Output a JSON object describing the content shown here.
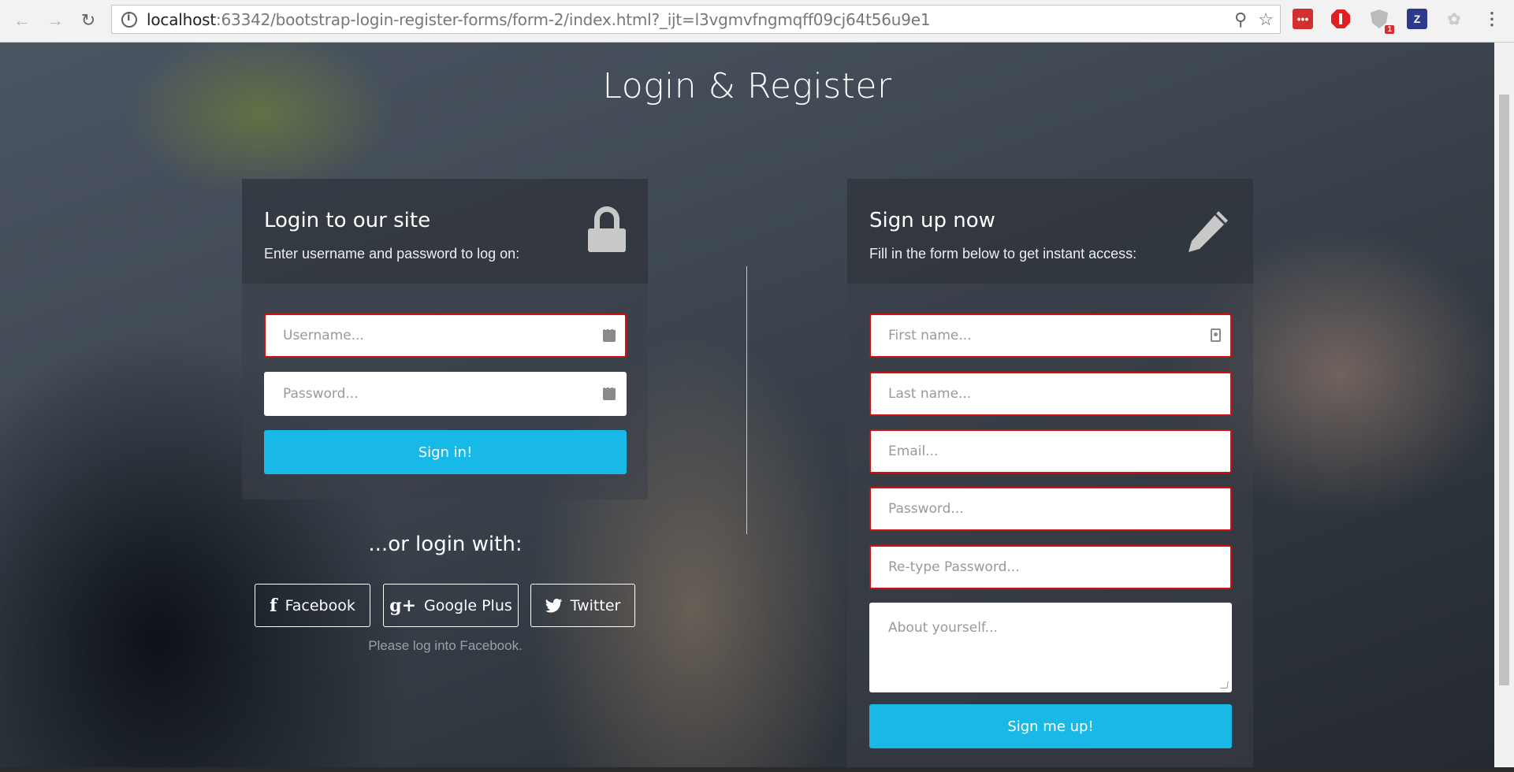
{
  "browser": {
    "url_host": "localhost",
    "url_rest": ":63342/bootstrap-login-register-forms/form-2/index.html?_ijt=l3vgmvfngmqff09cj64t56u9e1",
    "extension_badge": "1",
    "extension_z_label": "Z"
  },
  "page": {
    "title": "Login & Register"
  },
  "login": {
    "title": "Login to our site",
    "subtitle": "Enter username and password to log on:",
    "username_placeholder": "Username...",
    "password_placeholder": "Password...",
    "submit_label": "Sign in!"
  },
  "social": {
    "heading": "...or login with:",
    "facebook_label": "Facebook",
    "google_label": "Google Plus",
    "twitter_label": "Twitter",
    "note": "Please log into Facebook."
  },
  "signup": {
    "title": "Sign up now",
    "subtitle": "Fill in the form below to get instant access:",
    "first_name_placeholder": "First name...",
    "last_name_placeholder": "Last name...",
    "email_placeholder": "Email...",
    "password_placeholder": "Password...",
    "retype_placeholder": "Re-type Password...",
    "about_placeholder": "About yourself...",
    "submit_label": "Sign me up!"
  },
  "colors": {
    "accent": "#19b9e7",
    "error_border": "#d30f0f"
  }
}
